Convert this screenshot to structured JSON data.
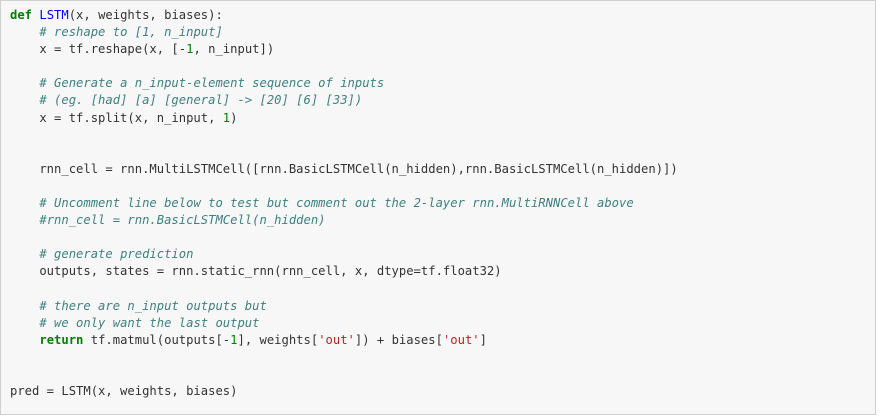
{
  "colors": {
    "cell_background": "#f7f7f7",
    "cell_border": "#cfcfcf",
    "keyword": "#008000",
    "function_name": "#0000ff",
    "comment": "#408080",
    "number": "#008000",
    "string": "#ba2121",
    "text": "#333333"
  },
  "code_lines": [
    [
      {
        "t": "def",
        "k": "kw"
      },
      {
        "t": " "
      },
      {
        "t": "LSTM",
        "k": "fn"
      },
      {
        "t": "(x, weights, biases):"
      }
    ],
    [
      {
        "t": "    "
      },
      {
        "t": "# reshape to [1, n_input]",
        "k": "cm"
      }
    ],
    [
      {
        "t": "    x = tf.reshape(x, [-"
      },
      {
        "t": "1",
        "k": "num"
      },
      {
        "t": ", n_input])"
      }
    ],
    [],
    [
      {
        "t": "    "
      },
      {
        "t": "# Generate a n_input-element sequence of inputs",
        "k": "cm"
      }
    ],
    [
      {
        "t": "    "
      },
      {
        "t": "# (eg. [had] [a] [general] -> [20] [6] [33])",
        "k": "cm"
      }
    ],
    [
      {
        "t": "    x = tf.split(x, n_input, "
      },
      {
        "t": "1",
        "k": "num"
      },
      {
        "t": ")"
      }
    ],
    [],
    [],
    [
      {
        "t": "    rnn_cell = rnn.MultiLSTMCell([rnn.BasicLSTMCell(n_hidden),rnn.BasicLSTMCell(n_hidden)])"
      }
    ],
    [],
    [
      {
        "t": "    "
      },
      {
        "t": "# Uncomment line below to test but comment out the 2-layer rnn.MultiRNNCell above",
        "k": "cm"
      }
    ],
    [
      {
        "t": "    "
      },
      {
        "t": "#rnn_cell = rnn.BasicLSTMCell(n_hidden)",
        "k": "cm"
      }
    ],
    [],
    [
      {
        "t": "    "
      },
      {
        "t": "# generate prediction",
        "k": "cm"
      }
    ],
    [
      {
        "t": "    outputs, states = rnn.static_rnn(rnn_cell, x, dtype=tf.float32)"
      }
    ],
    [],
    [
      {
        "t": "    "
      },
      {
        "t": "# there are n_input outputs but",
        "k": "cm"
      }
    ],
    [
      {
        "t": "    "
      },
      {
        "t": "# we only want the last output",
        "k": "cm"
      }
    ],
    [
      {
        "t": "    "
      },
      {
        "t": "return",
        "k": "kw"
      },
      {
        "t": " tf.matmul(outputs[-"
      },
      {
        "t": "1",
        "k": "num"
      },
      {
        "t": "], weights["
      },
      {
        "t": "'out'",
        "k": "str"
      },
      {
        "t": "]) + biases["
      },
      {
        "t": "'out'",
        "k": "str"
      },
      {
        "t": "]"
      }
    ],
    [],
    [],
    [
      {
        "t": "pred = LSTM(x, weights, biases)"
      }
    ]
  ]
}
